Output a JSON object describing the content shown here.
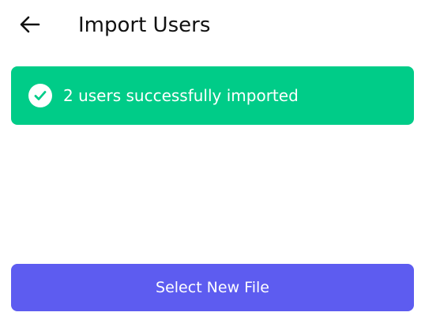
{
  "header": {
    "title": "Import Users",
    "back_icon": "arrow-left-icon"
  },
  "banner": {
    "message": "2 users successfully imported",
    "icon": "check-circle-icon",
    "color": "#00cc88"
  },
  "actions": {
    "select_file_label": "Select New File",
    "color": "#5d5cf0"
  }
}
